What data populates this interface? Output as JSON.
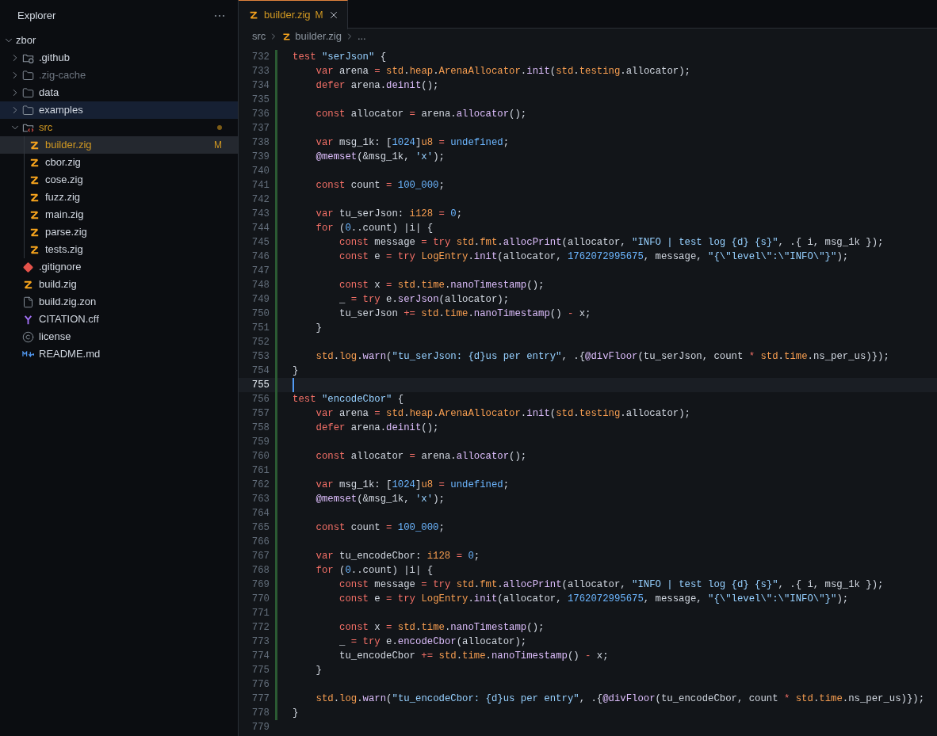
{
  "sidebar": {
    "title": "Explorer",
    "root": {
      "name": "zbor",
      "kind": "root",
      "expanded": true,
      "selected": false,
      "hovered": false,
      "ignored": false,
      "modified": false,
      "children": [
        {
          "name": ".github",
          "kind": "folder-github",
          "expanded": false,
          "selected": false,
          "hovered": false,
          "ignored": false,
          "modified": false
        },
        {
          "name": ".zig-cache",
          "kind": "folder",
          "expanded": false,
          "selected": false,
          "hovered": false,
          "ignored": true,
          "modified": false
        },
        {
          "name": "data",
          "kind": "folder",
          "expanded": false,
          "selected": false,
          "hovered": false,
          "ignored": false,
          "modified": false
        },
        {
          "name": "examples",
          "kind": "folder",
          "expanded": false,
          "selected": false,
          "hovered": true,
          "ignored": false,
          "modified": false
        },
        {
          "name": "src",
          "kind": "folder-src",
          "expanded": true,
          "selected": false,
          "hovered": false,
          "ignored": false,
          "modified": true,
          "children": [
            {
              "name": "builder.zig",
              "kind": "zig",
              "selected": true,
              "hovered": false,
              "ignored": false,
              "modified": true,
              "badge": "M"
            },
            {
              "name": "cbor.zig",
              "kind": "zig",
              "selected": false,
              "hovered": false,
              "ignored": false,
              "modified": false
            },
            {
              "name": "cose.zig",
              "kind": "zig",
              "selected": false,
              "hovered": false,
              "ignored": false,
              "modified": false
            },
            {
              "name": "fuzz.zig",
              "kind": "zig",
              "selected": false,
              "hovered": false,
              "ignored": false,
              "modified": false
            },
            {
              "name": "main.zig",
              "kind": "zig",
              "selected": false,
              "hovered": false,
              "ignored": false,
              "modified": false
            },
            {
              "name": "parse.zig",
              "kind": "zig",
              "selected": false,
              "hovered": false,
              "ignored": false,
              "modified": false
            },
            {
              "name": "tests.zig",
              "kind": "zig",
              "selected": false,
              "hovered": false,
              "ignored": false,
              "modified": false
            }
          ]
        },
        {
          "name": ".gitignore",
          "kind": "git",
          "selected": false,
          "hovered": false,
          "ignored": false,
          "modified": false
        },
        {
          "name": "build.zig",
          "kind": "zig",
          "selected": false,
          "hovered": false,
          "ignored": false,
          "modified": false
        },
        {
          "name": "build.zig.zon",
          "kind": "file",
          "selected": false,
          "hovered": false,
          "ignored": false,
          "modified": false
        },
        {
          "name": "CITATION.cff",
          "kind": "yaml",
          "selected": false,
          "hovered": false,
          "ignored": false,
          "modified": false
        },
        {
          "name": "license",
          "kind": "license",
          "selected": false,
          "hovered": false,
          "ignored": false,
          "modified": false
        },
        {
          "name": "README.md",
          "kind": "markdown",
          "selected": false,
          "hovered": false,
          "ignored": false,
          "modified": false
        }
      ]
    }
  },
  "tabs": [
    {
      "label": "builder.zig",
      "badge": "M",
      "selected": true,
      "modified": true
    }
  ],
  "breadcrumb": [
    "src",
    "builder.zig",
    "..."
  ],
  "editor": {
    "lines": [
      {
        "number": "732",
        "current": false,
        "added": true,
        "tokens": [
          {
            "kind": "kw",
            "text": "test"
          },
          {
            "kind": "str",
            "text": " \"serJson\""
          },
          {
            "kind": "id",
            "text": " {"
          }
        ]
      },
      {
        "number": "733",
        "current": false,
        "added": true,
        "tokens": [
          {
            "kind": "kw",
            "text": "    var"
          },
          {
            "kind": "id",
            "text": " arena "
          },
          {
            "kind": "op",
            "text": "="
          },
          {
            "kind": "ty",
            "text": " std"
          },
          {
            "kind": "id",
            "text": "."
          },
          {
            "kind": "ty",
            "text": "heap"
          },
          {
            "kind": "id",
            "text": "."
          },
          {
            "kind": "ty",
            "text": "ArenaAllocator"
          },
          {
            "kind": "id",
            "text": "."
          },
          {
            "kind": "fn",
            "text": "init"
          },
          {
            "kind": "id",
            "text": "("
          },
          {
            "kind": "ty",
            "text": "std"
          },
          {
            "kind": "id",
            "text": "."
          },
          {
            "kind": "ty",
            "text": "testing"
          },
          {
            "kind": "id",
            "text": ".allocator);"
          }
        ]
      },
      {
        "number": "734",
        "current": false,
        "added": true,
        "tokens": [
          {
            "kind": "kw",
            "text": "    defer"
          },
          {
            "kind": "id",
            "text": " arena."
          },
          {
            "kind": "fn",
            "text": "deinit"
          },
          {
            "kind": "id",
            "text": "();"
          }
        ]
      },
      {
        "number": "735",
        "current": false,
        "added": true
      },
      {
        "number": "736",
        "current": false,
        "added": true,
        "tokens": [
          {
            "kind": "kw",
            "text": "    const"
          },
          {
            "kind": "id",
            "text": " allocator "
          },
          {
            "kind": "op",
            "text": "="
          },
          {
            "kind": "id",
            "text": " arena."
          },
          {
            "kind": "fn",
            "text": "allocator"
          },
          {
            "kind": "id",
            "text": "();"
          }
        ]
      },
      {
        "number": "737",
        "current": false,
        "added": true
      },
      {
        "number": "738",
        "current": false,
        "added": true,
        "tokens": [
          {
            "kind": "kw",
            "text": "    var"
          },
          {
            "kind": "id",
            "text": " msg_1k: ["
          },
          {
            "kind": "num",
            "text": "1024"
          },
          {
            "kind": "id",
            "text": "]"
          },
          {
            "kind": "ty",
            "text": "u8"
          },
          {
            "kind": "op",
            "text": " ="
          },
          {
            "kind": "num",
            "text": " undefined"
          },
          {
            "kind": "id",
            "text": ";"
          }
        ]
      },
      {
        "number": "739",
        "current": false,
        "added": true,
        "tokens": [
          {
            "kind": "fn",
            "text": "    @memset"
          },
          {
            "kind": "id",
            "text": "(&msg_1k, "
          },
          {
            "kind": "str",
            "text": "'x'"
          },
          {
            "kind": "id",
            "text": ");"
          }
        ]
      },
      {
        "number": "740",
        "current": false,
        "added": true
      },
      {
        "number": "741",
        "current": false,
        "added": true,
        "tokens": [
          {
            "kind": "kw",
            "text": "    const"
          },
          {
            "kind": "id",
            "text": " count "
          },
          {
            "kind": "op",
            "text": "="
          },
          {
            "kind": "num",
            "text": " 100_000"
          },
          {
            "kind": "id",
            "text": ";"
          }
        ]
      },
      {
        "number": "742",
        "current": false,
        "added": true
      },
      {
        "number": "743",
        "current": false,
        "added": true,
        "tokens": [
          {
            "kind": "kw",
            "text": "    var"
          },
          {
            "kind": "id",
            "text": " tu_serJson: "
          },
          {
            "kind": "ty",
            "text": "i128"
          },
          {
            "kind": "op",
            "text": " ="
          },
          {
            "kind": "num",
            "text": " 0"
          },
          {
            "kind": "id",
            "text": ";"
          }
        ]
      },
      {
        "number": "744",
        "current": false,
        "added": true,
        "tokens": [
          {
            "kind": "kw",
            "text": "    for"
          },
          {
            "kind": "id",
            "text": " ("
          },
          {
            "kind": "num",
            "text": "0"
          },
          {
            "kind": "id",
            "text": "..count) |i| {"
          }
        ]
      },
      {
        "number": "745",
        "current": false,
        "added": true,
        "tokens": [
          {
            "kind": "kw",
            "text": "        const"
          },
          {
            "kind": "id",
            "text": " message "
          },
          {
            "kind": "op",
            "text": "="
          },
          {
            "kind": "kw",
            "text": " try"
          },
          {
            "kind": "ty",
            "text": " std"
          },
          {
            "kind": "id",
            "text": "."
          },
          {
            "kind": "ty",
            "text": "fmt"
          },
          {
            "kind": "id",
            "text": "."
          },
          {
            "kind": "fn",
            "text": "allocPrint"
          },
          {
            "kind": "id",
            "text": "(allocator, "
          },
          {
            "kind": "str",
            "text": "\"INFO | test log {d} {s}\""
          },
          {
            "kind": "id",
            "text": ", .{ i, msg_1k });"
          }
        ]
      },
      {
        "number": "746",
        "current": false,
        "added": true,
        "tokens": [
          {
            "kind": "kw",
            "text": "        const"
          },
          {
            "kind": "id",
            "text": " e "
          },
          {
            "kind": "op",
            "text": "="
          },
          {
            "kind": "kw",
            "text": " try"
          },
          {
            "kind": "ty",
            "text": " LogEntry"
          },
          {
            "kind": "id",
            "text": "."
          },
          {
            "kind": "fn",
            "text": "init"
          },
          {
            "kind": "id",
            "text": "(allocator, "
          },
          {
            "kind": "num",
            "text": "1762072995675"
          },
          {
            "kind": "id",
            "text": ", message, "
          },
          {
            "kind": "str",
            "text": "\"{\\\"level\\\":\\\"INFO\\\"}\""
          },
          {
            "kind": "id",
            "text": ");"
          }
        ]
      },
      {
        "number": "747",
        "current": false,
        "added": true
      },
      {
        "number": "748",
        "current": false,
        "added": true,
        "tokens": [
          {
            "kind": "kw",
            "text": "        const"
          },
          {
            "kind": "id",
            "text": " x "
          },
          {
            "kind": "op",
            "text": "="
          },
          {
            "kind": "ty",
            "text": " std"
          },
          {
            "kind": "id",
            "text": "."
          },
          {
            "kind": "ty",
            "text": "time"
          },
          {
            "kind": "id",
            "text": "."
          },
          {
            "kind": "fn",
            "text": "nanoTimestamp"
          },
          {
            "kind": "id",
            "text": "();"
          }
        ]
      },
      {
        "number": "749",
        "current": false,
        "added": true,
        "tokens": [
          {
            "kind": "id",
            "text": "        _ "
          },
          {
            "kind": "op",
            "text": "="
          },
          {
            "kind": "kw",
            "text": " try"
          },
          {
            "kind": "id",
            "text": " e."
          },
          {
            "kind": "fn",
            "text": "serJson"
          },
          {
            "kind": "id",
            "text": "(allocator);"
          }
        ]
      },
      {
        "number": "750",
        "current": false,
        "added": true,
        "tokens": [
          {
            "kind": "id",
            "text": "        tu_serJson "
          },
          {
            "kind": "op",
            "text": "+="
          },
          {
            "kind": "ty",
            "text": " std"
          },
          {
            "kind": "id",
            "text": "."
          },
          {
            "kind": "ty",
            "text": "time"
          },
          {
            "kind": "id",
            "text": "."
          },
          {
            "kind": "fn",
            "text": "nanoTimestamp"
          },
          {
            "kind": "id",
            "text": "() "
          },
          {
            "kind": "op",
            "text": "-"
          },
          {
            "kind": "id",
            "text": " x;"
          }
        ]
      },
      {
        "number": "751",
        "current": false,
        "added": true,
        "tokens": [
          {
            "kind": "id",
            "text": "    }"
          }
        ]
      },
      {
        "number": "752",
        "current": false,
        "added": true
      },
      {
        "number": "753",
        "current": false,
        "added": true,
        "tokens": [
          {
            "kind": "ty",
            "text": "    std"
          },
          {
            "kind": "id",
            "text": "."
          },
          {
            "kind": "ty",
            "text": "log"
          },
          {
            "kind": "id",
            "text": "."
          },
          {
            "kind": "fn",
            "text": "warn"
          },
          {
            "kind": "id",
            "text": "("
          },
          {
            "kind": "str",
            "text": "\"tu_serJson: {d}us per entry\""
          },
          {
            "kind": "id",
            "text": ", .{"
          },
          {
            "kind": "fn",
            "text": "@divFloor"
          },
          {
            "kind": "id",
            "text": "(tu_serJson, count "
          },
          {
            "kind": "op",
            "text": "*"
          },
          {
            "kind": "ty",
            "text": " std"
          },
          {
            "kind": "id",
            "text": "."
          },
          {
            "kind": "ty",
            "text": "time"
          },
          {
            "kind": "id",
            "text": ".ns_per_us)});"
          }
        ]
      },
      {
        "number": "754",
        "current": false,
        "added": true,
        "tokens": [
          {
            "kind": "id",
            "text": "}"
          }
        ]
      },
      {
        "number": "755",
        "current": true,
        "added": true
      },
      {
        "number": "756",
        "current": false,
        "added": true,
        "tokens": [
          {
            "kind": "kw",
            "text": "test"
          },
          {
            "kind": "str",
            "text": " \"encodeCbor\""
          },
          {
            "kind": "id",
            "text": " {"
          }
        ]
      },
      {
        "number": "757",
        "current": false,
        "added": true,
        "tokens": [
          {
            "kind": "kw",
            "text": "    var"
          },
          {
            "kind": "id",
            "text": " arena "
          },
          {
            "kind": "op",
            "text": "="
          },
          {
            "kind": "ty",
            "text": " std"
          },
          {
            "kind": "id",
            "text": "."
          },
          {
            "kind": "ty",
            "text": "heap"
          },
          {
            "kind": "id",
            "text": "."
          },
          {
            "kind": "ty",
            "text": "ArenaAllocator"
          },
          {
            "kind": "id",
            "text": "."
          },
          {
            "kind": "fn",
            "text": "init"
          },
          {
            "kind": "id",
            "text": "("
          },
          {
            "kind": "ty",
            "text": "std"
          },
          {
            "kind": "id",
            "text": "."
          },
          {
            "kind": "ty",
            "text": "testing"
          },
          {
            "kind": "id",
            "text": ".allocator);"
          }
        ]
      },
      {
        "number": "758",
        "current": false,
        "added": true,
        "tokens": [
          {
            "kind": "kw",
            "text": "    defer"
          },
          {
            "kind": "id",
            "text": " arena."
          },
          {
            "kind": "fn",
            "text": "deinit"
          },
          {
            "kind": "id",
            "text": "();"
          }
        ]
      },
      {
        "number": "759",
        "current": false,
        "added": true
      },
      {
        "number": "760",
        "current": false,
        "added": true,
        "tokens": [
          {
            "kind": "kw",
            "text": "    const"
          },
          {
            "kind": "id",
            "text": " allocator "
          },
          {
            "kind": "op",
            "text": "="
          },
          {
            "kind": "id",
            "text": " arena."
          },
          {
            "kind": "fn",
            "text": "allocator"
          },
          {
            "kind": "id",
            "text": "();"
          }
        ]
      },
      {
        "number": "761",
        "current": false,
        "added": true
      },
      {
        "number": "762",
        "current": false,
        "added": true,
        "tokens": [
          {
            "kind": "kw",
            "text": "    var"
          },
          {
            "kind": "id",
            "text": " msg_1k: ["
          },
          {
            "kind": "num",
            "text": "1024"
          },
          {
            "kind": "id",
            "text": "]"
          },
          {
            "kind": "ty",
            "text": "u8"
          },
          {
            "kind": "op",
            "text": " ="
          },
          {
            "kind": "num",
            "text": " undefined"
          },
          {
            "kind": "id",
            "text": ";"
          }
        ]
      },
      {
        "number": "763",
        "current": false,
        "added": true,
        "tokens": [
          {
            "kind": "fn",
            "text": "    @memset"
          },
          {
            "kind": "id",
            "text": "(&msg_1k, "
          },
          {
            "kind": "str",
            "text": "'x'"
          },
          {
            "kind": "id",
            "text": ");"
          }
        ]
      },
      {
        "number": "764",
        "current": false,
        "added": true
      },
      {
        "number": "765",
        "current": false,
        "added": true,
        "tokens": [
          {
            "kind": "kw",
            "text": "    const"
          },
          {
            "kind": "id",
            "text": " count "
          },
          {
            "kind": "op",
            "text": "="
          },
          {
            "kind": "num",
            "text": " 100_000"
          },
          {
            "kind": "id",
            "text": ";"
          }
        ]
      },
      {
        "number": "766",
        "current": false,
        "added": true
      },
      {
        "number": "767",
        "current": false,
        "added": true,
        "tokens": [
          {
            "kind": "kw",
            "text": "    var"
          },
          {
            "kind": "id",
            "text": " tu_encodeCbor: "
          },
          {
            "kind": "ty",
            "text": "i128"
          },
          {
            "kind": "op",
            "text": " ="
          },
          {
            "kind": "num",
            "text": " 0"
          },
          {
            "kind": "id",
            "text": ";"
          }
        ]
      },
      {
        "number": "768",
        "current": false,
        "added": true,
        "tokens": [
          {
            "kind": "kw",
            "text": "    for"
          },
          {
            "kind": "id",
            "text": " ("
          },
          {
            "kind": "num",
            "text": "0"
          },
          {
            "kind": "id",
            "text": "..count) |i| {"
          }
        ]
      },
      {
        "number": "769",
        "current": false,
        "added": true,
        "tokens": [
          {
            "kind": "kw",
            "text": "        const"
          },
          {
            "kind": "id",
            "text": " message "
          },
          {
            "kind": "op",
            "text": "="
          },
          {
            "kind": "kw",
            "text": " try"
          },
          {
            "kind": "ty",
            "text": " std"
          },
          {
            "kind": "id",
            "text": "."
          },
          {
            "kind": "ty",
            "text": "fmt"
          },
          {
            "kind": "id",
            "text": "."
          },
          {
            "kind": "fn",
            "text": "allocPrint"
          },
          {
            "kind": "id",
            "text": "(allocator, "
          },
          {
            "kind": "str",
            "text": "\"INFO | test log {d} {s}\""
          },
          {
            "kind": "id",
            "text": ", .{ i, msg_1k });"
          }
        ]
      },
      {
        "number": "770",
        "current": false,
        "added": true,
        "tokens": [
          {
            "kind": "kw",
            "text": "        const"
          },
          {
            "kind": "id",
            "text": " e "
          },
          {
            "kind": "op",
            "text": "="
          },
          {
            "kind": "kw",
            "text": " try"
          },
          {
            "kind": "ty",
            "text": " LogEntry"
          },
          {
            "kind": "id",
            "text": "."
          },
          {
            "kind": "fn",
            "text": "init"
          },
          {
            "kind": "id",
            "text": "(allocator, "
          },
          {
            "kind": "num",
            "text": "1762072995675"
          },
          {
            "kind": "id",
            "text": ", message, "
          },
          {
            "kind": "str",
            "text": "\"{\\\"level\\\":\\\"INFO\\\"}\""
          },
          {
            "kind": "id",
            "text": ");"
          }
        ]
      },
      {
        "number": "771",
        "current": false,
        "added": true
      },
      {
        "number": "772",
        "current": false,
        "added": true,
        "tokens": [
          {
            "kind": "kw",
            "text": "        const"
          },
          {
            "kind": "id",
            "text": " x "
          },
          {
            "kind": "op",
            "text": "="
          },
          {
            "kind": "ty",
            "text": " std"
          },
          {
            "kind": "id",
            "text": "."
          },
          {
            "kind": "ty",
            "text": "time"
          },
          {
            "kind": "id",
            "text": "."
          },
          {
            "kind": "fn",
            "text": "nanoTimestamp"
          },
          {
            "kind": "id",
            "text": "();"
          }
        ]
      },
      {
        "number": "773",
        "current": false,
        "added": true,
        "tokens": [
          {
            "kind": "id",
            "text": "        _ "
          },
          {
            "kind": "op",
            "text": "="
          },
          {
            "kind": "kw",
            "text": " try"
          },
          {
            "kind": "id",
            "text": " e."
          },
          {
            "kind": "fn",
            "text": "encodeCbor"
          },
          {
            "kind": "id",
            "text": "(allocator);"
          }
        ]
      },
      {
        "number": "774",
        "current": false,
        "added": true,
        "tokens": [
          {
            "kind": "id",
            "text": "        tu_encodeCbor "
          },
          {
            "kind": "op",
            "text": "+="
          },
          {
            "kind": "ty",
            "text": " std"
          },
          {
            "kind": "id",
            "text": "."
          },
          {
            "kind": "ty",
            "text": "time"
          },
          {
            "kind": "id",
            "text": "."
          },
          {
            "kind": "fn",
            "text": "nanoTimestamp"
          },
          {
            "kind": "id",
            "text": "() "
          },
          {
            "kind": "op",
            "text": "-"
          },
          {
            "kind": "id",
            "text": " x;"
          }
        ]
      },
      {
        "number": "775",
        "current": false,
        "added": true,
        "tokens": [
          {
            "kind": "id",
            "text": "    }"
          }
        ]
      },
      {
        "number": "776",
        "current": false,
        "added": true
      },
      {
        "number": "777",
        "current": false,
        "added": true,
        "tokens": [
          {
            "kind": "ty",
            "text": "    std"
          },
          {
            "kind": "id",
            "text": "."
          },
          {
            "kind": "ty",
            "text": "log"
          },
          {
            "kind": "id",
            "text": "."
          },
          {
            "kind": "fn",
            "text": "warn"
          },
          {
            "kind": "id",
            "text": "("
          },
          {
            "kind": "str",
            "text": "\"tu_encodeCbor: {d}us per entry\""
          },
          {
            "kind": "id",
            "text": ", .{"
          },
          {
            "kind": "fn",
            "text": "@divFloor"
          },
          {
            "kind": "id",
            "text": "(tu_encodeCbor, count "
          },
          {
            "kind": "op",
            "text": "*"
          },
          {
            "kind": "ty",
            "text": " std"
          },
          {
            "kind": "id",
            "text": "."
          },
          {
            "kind": "ty",
            "text": "time"
          },
          {
            "kind": "id",
            "text": ".ns_per_us)});"
          }
        ]
      },
      {
        "number": "778",
        "current": false,
        "added": true,
        "tokens": [
          {
            "kind": "id",
            "text": "}"
          }
        ]
      },
      {
        "number": "779",
        "current": false,
        "added": false
      }
    ]
  }
}
